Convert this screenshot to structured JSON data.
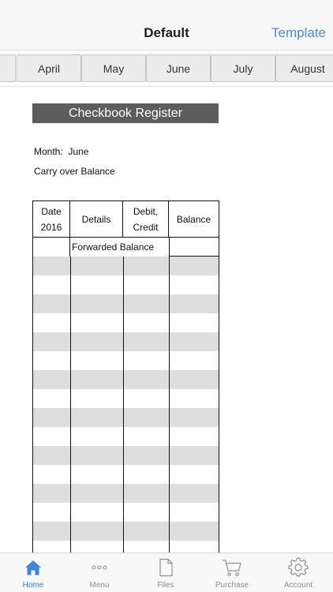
{
  "nav": {
    "title": "Default",
    "right_button": "Template"
  },
  "months": {
    "items": [
      {
        "label": ""
      },
      {
        "label": "April"
      },
      {
        "label": "May"
      },
      {
        "label": "June"
      },
      {
        "label": "July"
      },
      {
        "label": "August"
      }
    ]
  },
  "document": {
    "title": "Checkbook Register",
    "month_label": "Month:",
    "month_value": "June",
    "carry_over": "Carry over Balance"
  },
  "register": {
    "headers": {
      "date_line1": "Date",
      "date_line2": "2016",
      "details": "Details",
      "debit_line1": "Debit,",
      "debit_line2": "Credit",
      "balance": "Balance"
    },
    "forwarded": "Forwarded Balance"
  },
  "tabs": {
    "items": [
      {
        "label": "Home",
        "icon": "home-icon",
        "active": true
      },
      {
        "label": "Menu",
        "icon": "more-dots-icon",
        "active": false
      },
      {
        "label": "Files",
        "icon": "file-icon",
        "active": false
      },
      {
        "label": "Purchase",
        "icon": "cart-icon",
        "active": false
      },
      {
        "label": "Account",
        "icon": "gear-icon",
        "active": false
      }
    ]
  },
  "colors": {
    "accent": "#4a90d9",
    "title_bar": "#5d5d5d",
    "row_shade": "#dedede"
  }
}
